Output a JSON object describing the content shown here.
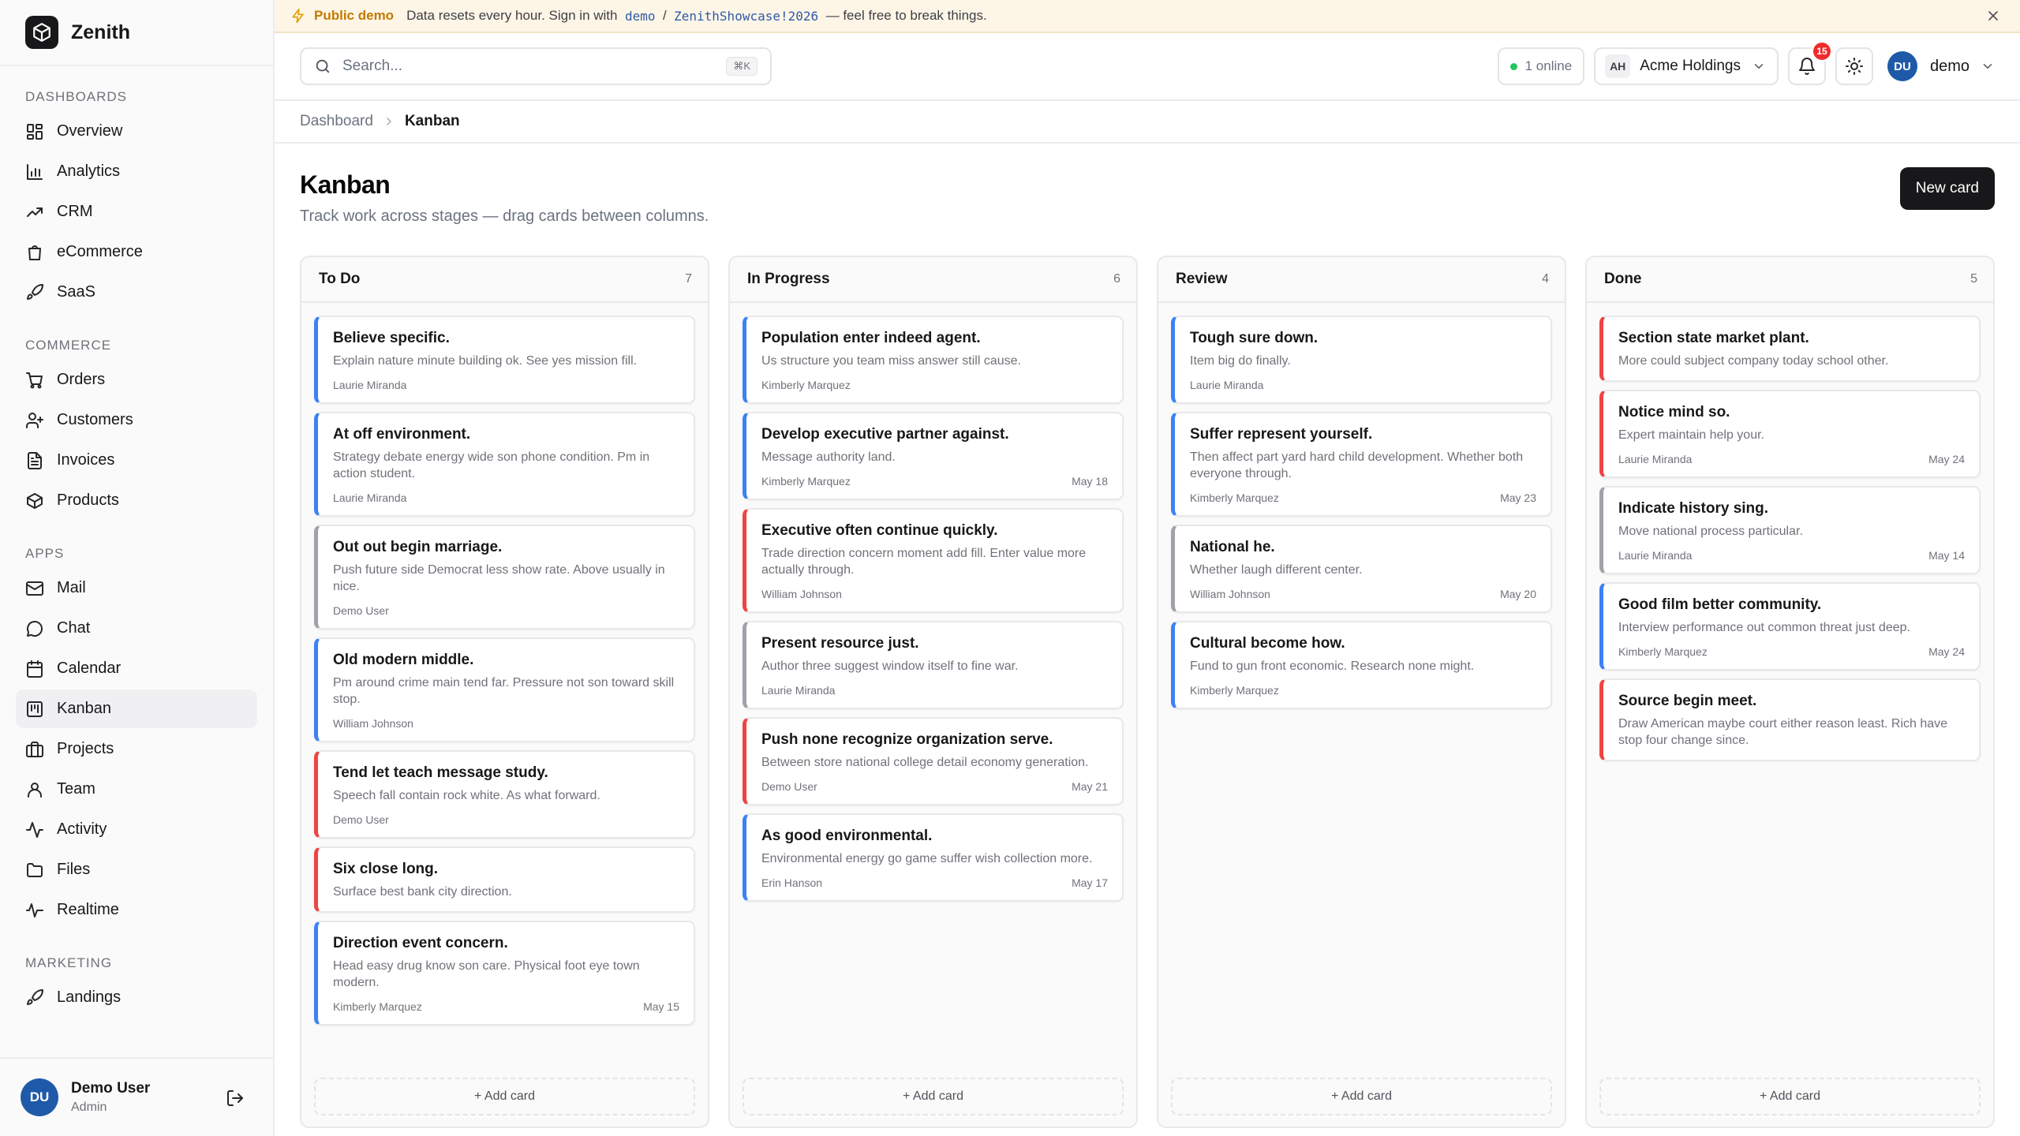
{
  "app": {
    "name": "Zenith"
  },
  "sidebar": {
    "sections": [
      {
        "label": "DASHBOARDS",
        "items": [
          {
            "label": "Overview",
            "icon": "grid-icon"
          },
          {
            "label": "Analytics",
            "icon": "bar-chart-icon"
          },
          {
            "label": "CRM",
            "icon": "trending-up-icon"
          },
          {
            "label": "eCommerce",
            "icon": "shopping-bag-icon"
          },
          {
            "label": "SaaS",
            "icon": "rocket-icon"
          }
        ]
      },
      {
        "label": "COMMERCE",
        "items": [
          {
            "label": "Orders",
            "icon": "cart-icon"
          },
          {
            "label": "Customers",
            "icon": "user-plus-icon"
          },
          {
            "label": "Invoices",
            "icon": "file-text-icon"
          },
          {
            "label": "Products",
            "icon": "package-icon"
          }
        ]
      },
      {
        "label": "APPS",
        "items": [
          {
            "label": "Mail",
            "icon": "mail-icon"
          },
          {
            "label": "Chat",
            "icon": "chat-bubble-icon"
          },
          {
            "label": "Calendar",
            "icon": "calendar-icon"
          },
          {
            "label": "Kanban",
            "icon": "kanban-icon",
            "active": true
          },
          {
            "label": "Projects",
            "icon": "briefcase-icon"
          },
          {
            "label": "Team",
            "icon": "user-icon"
          },
          {
            "label": "Activity",
            "icon": "activity-icon"
          },
          {
            "label": "Files",
            "icon": "folder-icon"
          },
          {
            "label": "Realtime",
            "icon": "pulse-icon"
          }
        ]
      },
      {
        "label": "MARKETING",
        "items": [
          {
            "label": "Landings",
            "icon": "rocket-icon"
          }
        ]
      }
    ],
    "footer": {
      "initials": "DU",
      "name": "Demo User",
      "role": "Admin"
    }
  },
  "banner": {
    "label": "Public demo",
    "text_before": "Data resets every hour. Sign in with",
    "username": "demo",
    "separator": "/",
    "password": "ZenithShowcase!2026",
    "text_after": "— feel free to break things."
  },
  "topbar": {
    "search_placeholder": "Search...",
    "search_shortcut": "⌘K",
    "online_text": "1 online",
    "org_initials": "AH",
    "org_name": "Acme Holdings",
    "notification_count": "15",
    "user_initials": "DU",
    "user_name": "demo"
  },
  "breadcrumb": {
    "parent": "Dashboard",
    "current": "Kanban"
  },
  "page": {
    "title": "Kanban",
    "subtitle": "Track work across stages — drag cards between columns.",
    "new_card_label": "New card",
    "add_card_label": "+ Add card"
  },
  "colors": {
    "blue": "#3b82f6",
    "red": "#ef4444",
    "gray": "#a1a1aa"
  },
  "columns": [
    {
      "title": "To Do",
      "count": "7",
      "cards": [
        {
          "title": "Believe specific.",
          "desc": "Explain nature minute building ok. See yes mission fill.",
          "assignee": "Laurie Miranda",
          "date": "",
          "color": "blue"
        },
        {
          "title": "At off environment.",
          "desc": "Strategy debate energy wide son phone condition. Pm in action student.",
          "assignee": "Laurie Miranda",
          "date": "",
          "color": "blue"
        },
        {
          "title": "Out out begin marriage.",
          "desc": "Push future side Democrat less show rate. Above usually in nice.",
          "assignee": "Demo User",
          "date": "",
          "color": "gray"
        },
        {
          "title": "Old modern middle.",
          "desc": "Pm around crime main tend far. Pressure not son toward skill stop.",
          "assignee": "William Johnson",
          "date": "",
          "color": "blue"
        },
        {
          "title": "Tend let teach message study.",
          "desc": "Speech fall contain rock white. As what forward.",
          "assignee": "Demo User",
          "date": "",
          "color": "red"
        },
        {
          "title": "Six close long.",
          "desc": "Surface best bank city direction.",
          "assignee": "",
          "date": "",
          "color": "red"
        },
        {
          "title": "Direction event concern.",
          "desc": "Head easy drug know son care. Physical foot eye town modern.",
          "assignee": "Kimberly Marquez",
          "date": "May 15",
          "color": "blue"
        }
      ]
    },
    {
      "title": "In Progress",
      "count": "6",
      "cards": [
        {
          "title": "Population enter indeed agent.",
          "desc": "Us structure you team miss answer still cause.",
          "assignee": "Kimberly Marquez",
          "date": "",
          "color": "blue"
        },
        {
          "title": "Develop executive partner against.",
          "desc": "Message authority land.",
          "assignee": "Kimberly Marquez",
          "date": "May 18",
          "color": "blue"
        },
        {
          "title": "Executive often continue quickly.",
          "desc": "Trade direction concern moment add fill. Enter value more actually through.",
          "assignee": "William Johnson",
          "date": "",
          "color": "red"
        },
        {
          "title": "Present resource just.",
          "desc": "Author three suggest window itself to fine war.",
          "assignee": "Laurie Miranda",
          "date": "",
          "color": "gray"
        },
        {
          "title": "Push none recognize organization serve.",
          "desc": "Between store national college detail economy generation.",
          "assignee": "Demo User",
          "date": "May 21",
          "color": "red"
        },
        {
          "title": "As good environmental.",
          "desc": "Environmental energy go game suffer wish collection more.",
          "assignee": "Erin Hanson",
          "date": "May 17",
          "color": "blue"
        }
      ]
    },
    {
      "title": "Review",
      "count": "4",
      "cards": [
        {
          "title": "Tough sure down.",
          "desc": "Item big do finally.",
          "assignee": "Laurie Miranda",
          "date": "",
          "color": "blue"
        },
        {
          "title": "Suffer represent yourself.",
          "desc": "Then affect part yard hard child development. Whether both everyone through.",
          "assignee": "Kimberly Marquez",
          "date": "May 23",
          "color": "blue"
        },
        {
          "title": "National he.",
          "desc": "Whether laugh different center.",
          "assignee": "William Johnson",
          "date": "May 20",
          "color": "gray"
        },
        {
          "title": "Cultural become how.",
          "desc": "Fund to gun front economic. Research none might.",
          "assignee": "Kimberly Marquez",
          "date": "",
          "color": "blue"
        }
      ]
    },
    {
      "title": "Done",
      "count": "5",
      "cards": [
        {
          "title": "Section state market plant.",
          "desc": "More could subject company today school other.",
          "assignee": "",
          "date": "",
          "color": "red"
        },
        {
          "title": "Notice mind so.",
          "desc": "Expert maintain help your.",
          "assignee": "Laurie Miranda",
          "date": "May 24",
          "color": "red"
        },
        {
          "title": "Indicate history sing.",
          "desc": "Move national process particular.",
          "assignee": "Laurie Miranda",
          "date": "May 14",
          "color": "gray"
        },
        {
          "title": "Good film better community.",
          "desc": "Interview performance out common threat just deep.",
          "assignee": "Kimberly Marquez",
          "date": "May 24",
          "color": "blue"
        },
        {
          "title": "Source begin meet.",
          "desc": "Draw American maybe court either reason least. Rich have stop four change since.",
          "assignee": "",
          "date": "",
          "color": "red"
        }
      ]
    }
  ]
}
